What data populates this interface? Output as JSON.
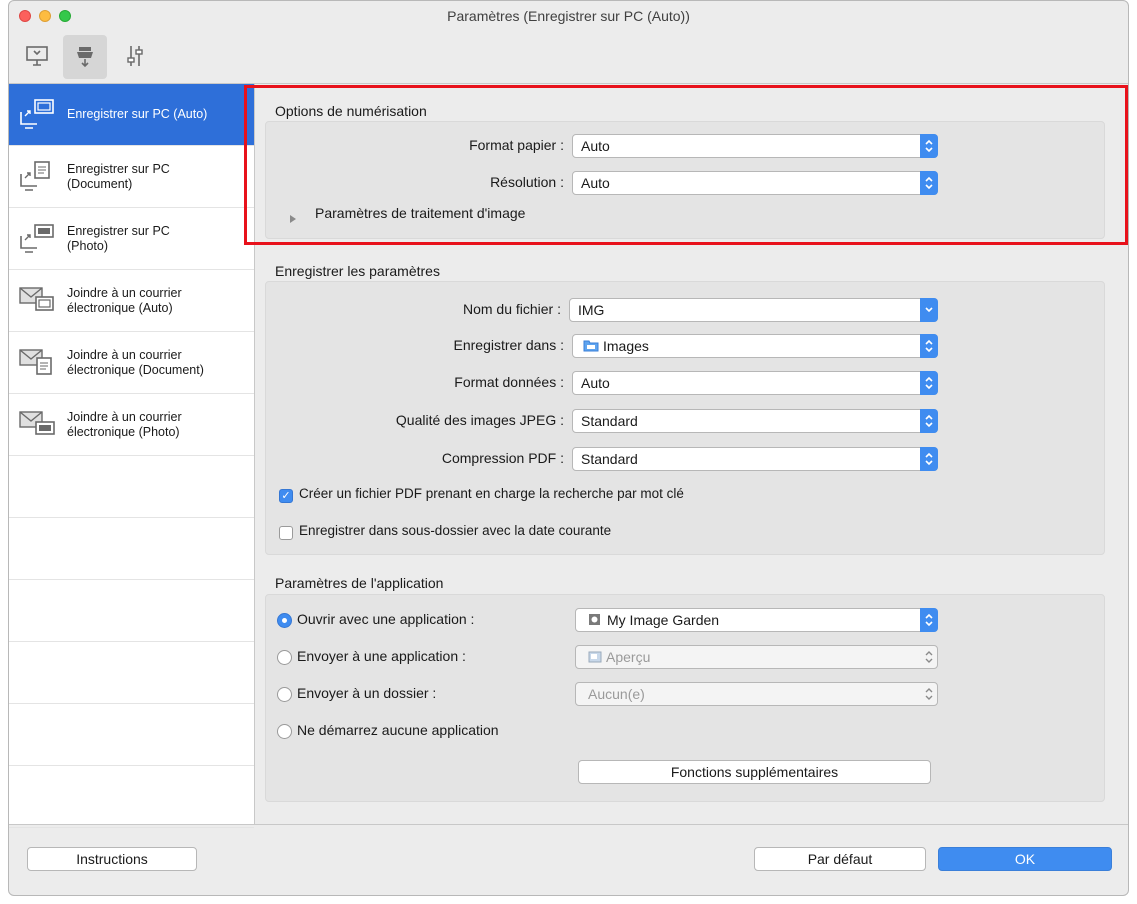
{
  "window": {
    "title": "Paramètres (Enregistrer sur PC (Auto))"
  },
  "toolbar": {
    "tabs": [
      "scan-from-computer-icon",
      "scan-from-panel-icon",
      "general-settings-icon"
    ],
    "selected_tab": 1
  },
  "sidebar": {
    "items": [
      {
        "label": "Enregistrer sur PC (Auto)",
        "icon": "save-to-pc-auto-icon",
        "selected": true
      },
      {
        "label": "Enregistrer sur PC\n(Document)",
        "icon": "save-to-pc-document-icon"
      },
      {
        "label": "Enregistrer sur PC\n(Photo)",
        "icon": "save-to-pc-photo-icon"
      },
      {
        "label": "Joindre à un courrier\nélectronique (Auto)",
        "icon": "attach-email-auto-icon"
      },
      {
        "label": "Joindre à un courrier\nélectronique (Document)",
        "icon": "attach-email-document-icon"
      },
      {
        "label": "Joindre à un courrier\nélectronique (Photo)",
        "icon": "attach-email-photo-icon"
      }
    ]
  },
  "scan_options": {
    "title": "Options de numérisation",
    "paper_size_label": "Format papier :",
    "paper_size_value": "Auto",
    "resolution_label": "Résolution :",
    "resolution_value": "Auto",
    "image_processing_label": "Paramètres de traitement d'image"
  },
  "save_settings": {
    "title": "Enregistrer les paramètres",
    "file_name_label": "Nom du fichier :",
    "file_name_value": "IMG",
    "save_in_label": "Enregistrer dans :",
    "save_in_value": "Images",
    "data_format_label": "Format données :",
    "data_format_value": "Auto",
    "jpeg_quality_label": "Qualité des images JPEG :",
    "jpeg_quality_value": "Standard",
    "pdf_compression_label": "Compression PDF :",
    "pdf_compression_value": "Standard",
    "keyword_pdf_label": "Créer un fichier PDF prenant en charge la recherche par mot clé",
    "keyword_pdf_checked": true,
    "subfolder_label": "Enregistrer dans sous-dossier avec la date courante",
    "subfolder_checked": false
  },
  "app_settings": {
    "title": "Paramètres de l'application",
    "open_app_label": "Ouvrir avec une application :",
    "open_app_value": "My Image Garden",
    "send_app_label": "Envoyer à une application :",
    "send_app_value": "Aperçu",
    "send_folder_label": "Envoyer à un dossier :",
    "send_folder_value": "Aucun(e)",
    "no_app_label": "Ne démarrez aucune application",
    "selected_option": "open_app",
    "more_functions_label": "Fonctions supplémentaires"
  },
  "footer": {
    "instructions_label": "Instructions",
    "defaults_label": "Par défaut",
    "ok_label": "OK"
  },
  "colors": {
    "accent": "#3f8cf0",
    "highlight_border": "#e8111b",
    "sidebar_selected": "#2e6fd9"
  }
}
